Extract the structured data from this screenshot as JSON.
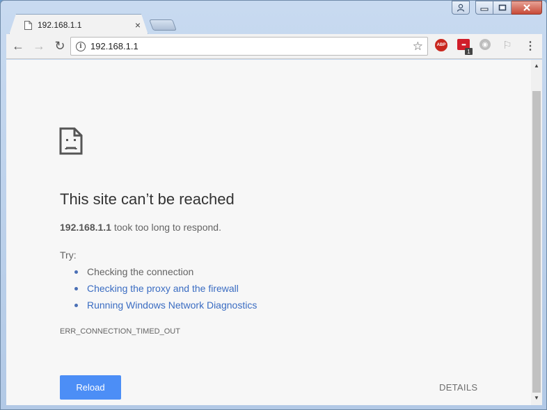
{
  "window": {
    "caption": {
      "user_icon": "user-icon",
      "minimize_icon": "minimize-icon",
      "maximize_icon": "maximize-icon",
      "close_icon": "close-icon"
    }
  },
  "tab": {
    "title": "192.168.1.1",
    "icon": "page-icon",
    "close_label": "×"
  },
  "toolbar": {
    "back_icon": "←",
    "forward_icon": "→",
    "reload_icon": "↻",
    "url": "192.168.1.1",
    "info_icon": "i",
    "star_icon": "☆",
    "extensions": {
      "abp_label": "ABP",
      "lastpass_label": "•••",
      "lastpass_badge": "1",
      "ghostery_label": "◉",
      "pdf_label": "⚐",
      "menu_label": "⋮"
    }
  },
  "error_page": {
    "headline": "This site can’t be reached",
    "host": "192.168.1.1",
    "summary_rest": " took too long to respond.",
    "try_label": "Try:",
    "suggestions": [
      {
        "text": "Checking the connection",
        "link": false
      },
      {
        "text": "Checking the proxy and the firewall",
        "link": true
      },
      {
        "text": "Running Windows Network Diagnostics",
        "link": true
      }
    ],
    "error_code": "ERR_CONNECTION_TIMED_OUT",
    "reload_button": "Reload",
    "details_button": "DETAILS"
  },
  "scrollbar": {
    "up_arrow": "▲",
    "down_arrow": "▼"
  },
  "colors": {
    "accent_button": "#4c8ef6",
    "link": "#3a6cc2",
    "page_bg": "#f7f7f7"
  }
}
